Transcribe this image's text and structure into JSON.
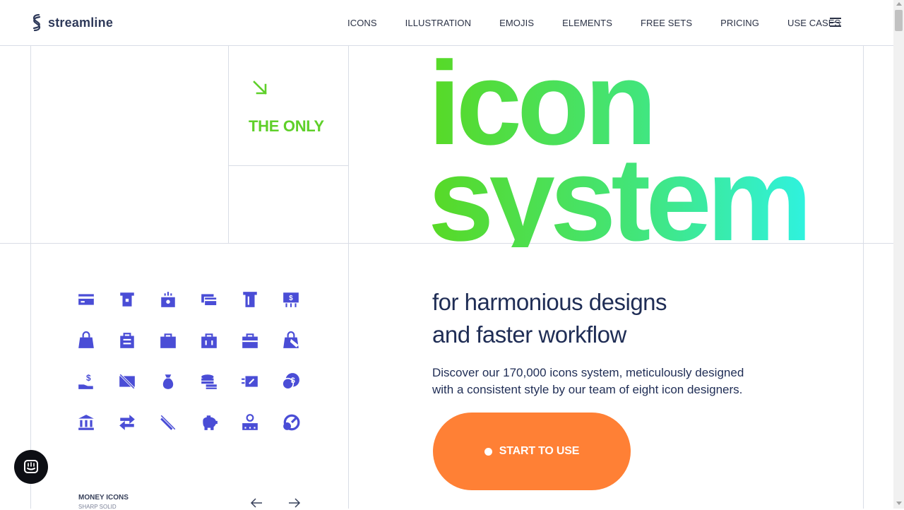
{
  "header": {
    "logo_text": "streamline",
    "nav": [
      "ICONS",
      "ILLUSTRATION",
      "EMOJIS",
      "ELEMENTS",
      "FREE SETS",
      "PRICING",
      "USE CASES"
    ]
  },
  "left_panel": {
    "the_only": "THE ONLY",
    "icon_set_label": "MONEY ICONS",
    "icon_set_style": "SHARP SOLID",
    "icon_names": [
      [
        "credit-card-icon",
        "atm-card-icon",
        "cash-register-icon",
        "cards-icon",
        "atm-icon",
        "money-sign-board-icon"
      ],
      [
        "shopping-bag-icon",
        "shopping-bag-list-icon",
        "bag-icon",
        "basket-icon",
        "briefcase-icon",
        "bag-discount-icon"
      ],
      [
        "hand-dollar-icon",
        "no-cash-icon",
        "money-bag-icon",
        "coin-stack-icon",
        "cash-transfer-icon",
        "coin-dollar-icon"
      ],
      [
        "bank-icon",
        "exchange-arrows-icon",
        "no-payment-icon",
        "piggy-bank-icon",
        "cash-register-machine-icon",
        "gauge-coin-icon"
      ]
    ]
  },
  "hero": {
    "title_line1": "icon",
    "title_line2": "system",
    "subhead_line1": "for harmonious designs",
    "subhead_line2": "and faster workflow",
    "description": "Discover our 170,000 icons system, meticulously designed with a consistent style by our team of eight icon designers.",
    "cta": "START TO USE"
  },
  "colors": {
    "accent_green": "#5fd02a",
    "gradient_start": "#58d925",
    "gradient_end": "#2ff2df",
    "icon_color": "#4a4dd6",
    "cta_orange": "#ff8035",
    "text_navy": "#1f2d55"
  }
}
